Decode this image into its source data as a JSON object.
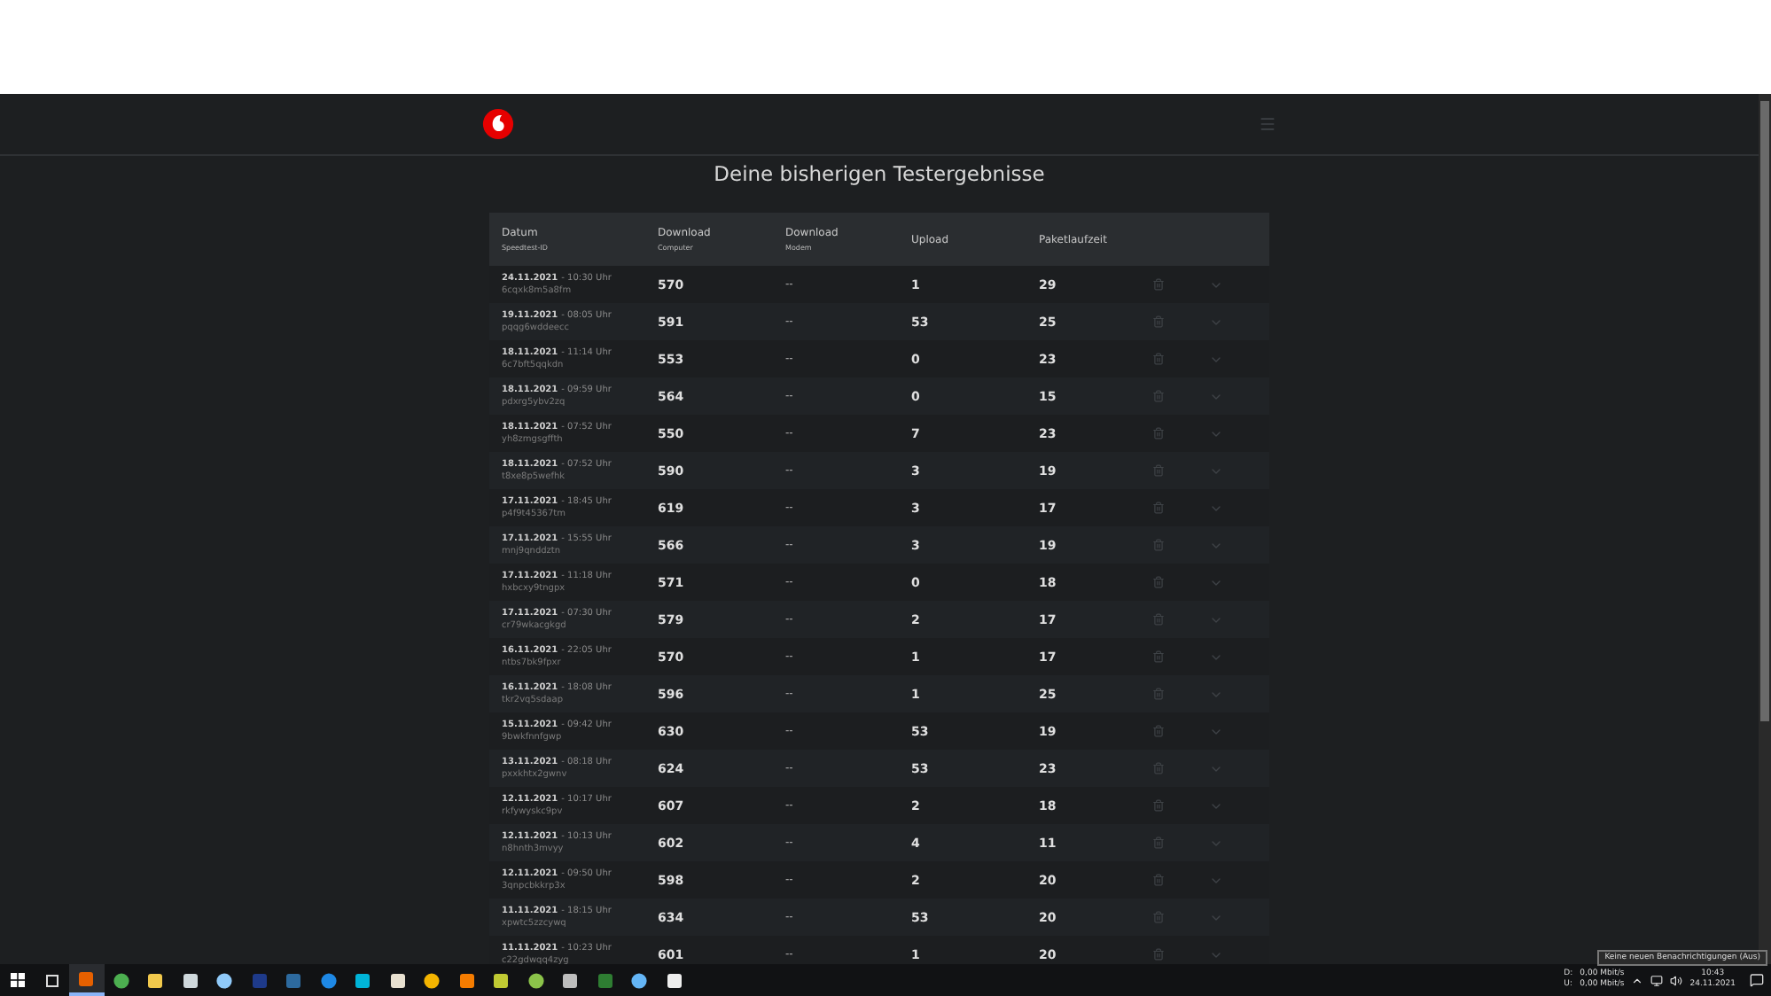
{
  "page": {
    "title": "Deine bisherigen Testergebnisse"
  },
  "table": {
    "columns": [
      {
        "label": "Datum",
        "sublabel": "Speedtest-ID"
      },
      {
        "label": "Download",
        "sublabel": "Computer"
      },
      {
        "label": "Download",
        "sublabel": "Modem"
      },
      {
        "label": "Upload"
      },
      {
        "label": "Paketlaufzeit"
      }
    ],
    "rows": [
      {
        "date": "24.11.2021",
        "time": "- 10:30 Uhr",
        "id": "6cqxk8m5a8fm",
        "download_computer": "570",
        "download_modem": "--",
        "upload": "1",
        "latency": "29"
      },
      {
        "date": "19.11.2021",
        "time": "- 08:05 Uhr",
        "id": "pqqg6wddeecc",
        "download_computer": "591",
        "download_modem": "--",
        "upload": "53",
        "latency": "25"
      },
      {
        "date": "18.11.2021",
        "time": "- 11:14 Uhr",
        "id": "6c7bft5qqkdn",
        "download_computer": "553",
        "download_modem": "--",
        "upload": "0",
        "latency": "23"
      },
      {
        "date": "18.11.2021",
        "time": "- 09:59 Uhr",
        "id": "pdxrg5ybv2zq",
        "download_computer": "564",
        "download_modem": "--",
        "upload": "0",
        "latency": "15"
      },
      {
        "date": "18.11.2021",
        "time": "- 07:52 Uhr",
        "id": "yh8zmgsgffth",
        "download_computer": "550",
        "download_modem": "--",
        "upload": "7",
        "latency": "23"
      },
      {
        "date": "18.11.2021",
        "time": "- 07:52 Uhr",
        "id": "t8xe8p5wefhk",
        "download_computer": "590",
        "download_modem": "--",
        "upload": "3",
        "latency": "19"
      },
      {
        "date": "17.11.2021",
        "time": "- 18:45 Uhr",
        "id": "p4f9t45367tm",
        "download_computer": "619",
        "download_modem": "--",
        "upload": "3",
        "latency": "17"
      },
      {
        "date": "17.11.2021",
        "time": "- 15:55 Uhr",
        "id": "mnj9qnddztn",
        "download_computer": "566",
        "download_modem": "--",
        "upload": "3",
        "latency": "19"
      },
      {
        "date": "17.11.2021",
        "time": "- 11:18 Uhr",
        "id": "hxbcxy9tngpx",
        "download_computer": "571",
        "download_modem": "--",
        "upload": "0",
        "latency": "18"
      },
      {
        "date": "17.11.2021",
        "time": "- 07:30 Uhr",
        "id": "cr79wkacgkgd",
        "download_computer": "579",
        "download_modem": "--",
        "upload": "2",
        "latency": "17"
      },
      {
        "date": "16.11.2021",
        "time": "- 22:05 Uhr",
        "id": "ntbs7bk9fpxr",
        "download_computer": "570",
        "download_modem": "--",
        "upload": "1",
        "latency": "17"
      },
      {
        "date": "16.11.2021",
        "time": "- 18:08 Uhr",
        "id": "tkr2vq5sdaap",
        "download_computer": "596",
        "download_modem": "--",
        "upload": "1",
        "latency": "25"
      },
      {
        "date": "15.11.2021",
        "time": "- 09:42 Uhr",
        "id": "9bwkfnnfgwp",
        "download_computer": "630",
        "download_modem": "--",
        "upload": "53",
        "latency": "19"
      },
      {
        "date": "13.11.2021",
        "time": "- 08:18 Uhr",
        "id": "pxxkhtx2gwnv",
        "download_computer": "624",
        "download_modem": "--",
        "upload": "53",
        "latency": "23"
      },
      {
        "date": "12.11.2021",
        "time": "- 10:17 Uhr",
        "id": "rkfywyskc9pv",
        "download_computer": "607",
        "download_modem": "--",
        "upload": "2",
        "latency": "18"
      },
      {
        "date": "12.11.2021",
        "time": "- 10:13 Uhr",
        "id": "n8hnth3mvyy",
        "download_computer": "602",
        "download_modem": "--",
        "upload": "4",
        "latency": "11"
      },
      {
        "date": "12.11.2021",
        "time": "- 09:50 Uhr",
        "id": "3qnpcbkkrp3x",
        "download_computer": "598",
        "download_modem": "--",
        "upload": "2",
        "latency": "20"
      },
      {
        "date": "11.11.2021",
        "time": "- 18:15 Uhr",
        "id": "xpwtc5zzcywq",
        "download_computer": "634",
        "download_modem": "--",
        "upload": "53",
        "latency": "20"
      },
      {
        "date": "11.11.2021",
        "time": "- 10:23 Uhr",
        "id": "c22gdwqq4zyg",
        "download_computer": "601",
        "download_modem": "--",
        "upload": "1",
        "latency": "20"
      }
    ]
  },
  "taskbar": {
    "tray": {
      "download_label": "D:",
      "upload_label": "U:",
      "download_rate": "0,00 Mbit/s",
      "upload_rate": "0,00 Mbit/s",
      "time": "10:43",
      "date": "24.11.2021"
    },
    "tooltip": "Keine neuen Benachrichtigungen (Aus)"
  }
}
